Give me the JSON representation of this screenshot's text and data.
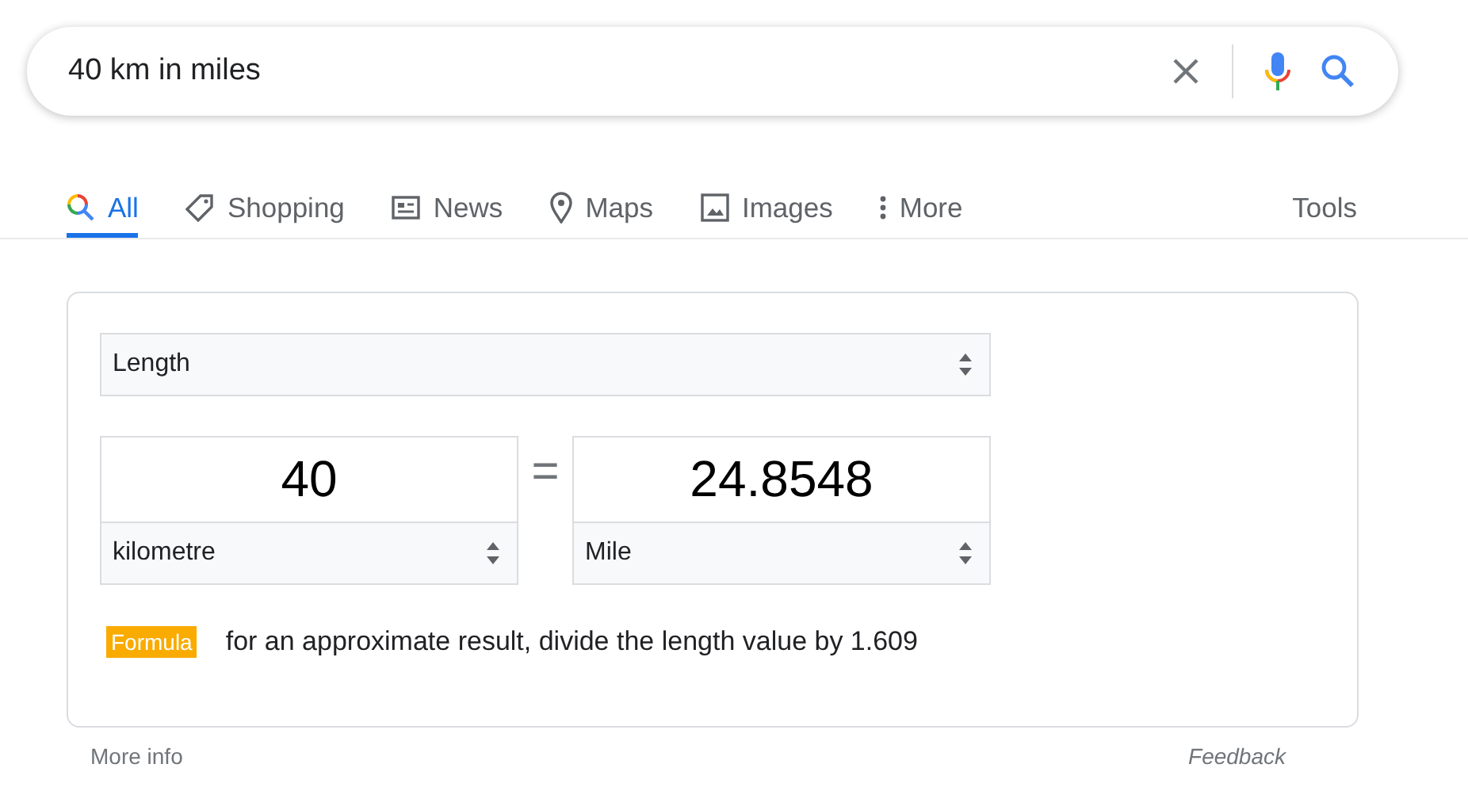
{
  "search": {
    "value": "40 km in miles"
  },
  "tabs": [
    {
      "label": "All",
      "kind": "all",
      "selected": true
    },
    {
      "label": "Shopping",
      "kind": "shopping",
      "selected": false
    },
    {
      "label": "News",
      "kind": "news",
      "selected": false
    },
    {
      "label": "Maps",
      "kind": "maps",
      "selected": false
    },
    {
      "label": "Images",
      "kind": "images",
      "selected": false
    },
    {
      "label": "More",
      "kind": "more",
      "selected": false
    }
  ],
  "tools": "Tools",
  "converter": {
    "quantity": "Length",
    "from": {
      "value": "40",
      "unit": "kilometre"
    },
    "equals": "=",
    "to": {
      "value": "24.8548",
      "unit": "Mile"
    },
    "formula_badge": "Formula",
    "formula": "for an approximate result, divide the length value by 1.609"
  },
  "footer": {
    "more_info": "More info",
    "feedback": "Feedback"
  }
}
